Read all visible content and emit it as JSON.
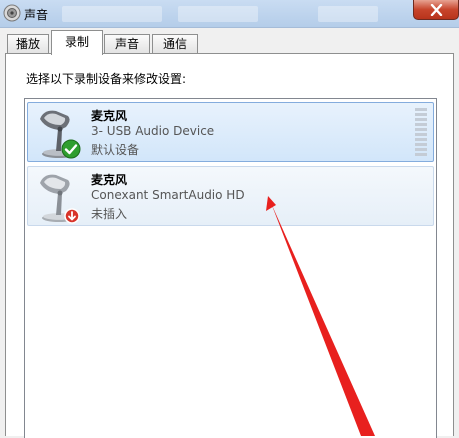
{
  "window": {
    "title": "声音",
    "icon": "speaker-icon",
    "close_icon": "close-icon"
  },
  "tabs": [
    {
      "label": "播放",
      "active": false
    },
    {
      "label": "录制",
      "active": true
    },
    {
      "label": "声音",
      "active": false
    },
    {
      "label": "通信",
      "active": false
    }
  ],
  "panel": {
    "instruction": "选择以下录制设备来修改设置:"
  },
  "devices": [
    {
      "name": "麦克风",
      "description": "3- USB Audio Device",
      "status": "默认设备",
      "selected": true,
      "icon": "microphone-icon",
      "badge_icon": "green-check-icon"
    },
    {
      "name": "麦克风",
      "description": "Conexant SmartAudio HD",
      "status": "未插入",
      "selected": false,
      "icon": "microphone-icon",
      "badge_icon": "red-down-arrow-icon"
    }
  ],
  "colors": {
    "selection_bg": "#d2e6fa",
    "selection_border": "#84acdd",
    "annotation": "#e8201e",
    "check_badge": "#2f9e2f",
    "unplugged_badge": "#d8342a"
  }
}
